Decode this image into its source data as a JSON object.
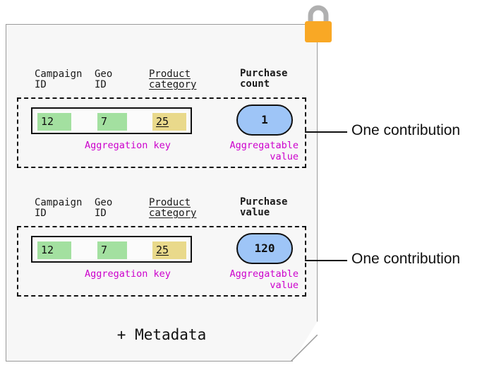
{
  "document": {
    "metadata_label": "+ Metadata",
    "lock_icon": "padlock-icon",
    "sheet_color": "#f7f7f7",
    "border_color": "#9a9a9a"
  },
  "colors": {
    "key_green": "#a3e0a0",
    "key_yellow": "#e9d98b",
    "value_blue": "#9ec5f7",
    "annotation_purple": "#cc00cc",
    "lock_body": "#f9a825",
    "lock_shackle": "#b0b0b0"
  },
  "contributions": [
    {
      "headers": {
        "campaign": "Campaign\nID",
        "geo": "Geo\nID",
        "product": "Product\ncategory",
        "metric": "Purchase\ncount"
      },
      "key": {
        "campaign_id": "12",
        "geo_id": "7",
        "product_category": "25"
      },
      "value": "1",
      "key_label": "Aggregation key",
      "value_label": "Aggregatable\nvalue",
      "callout": "One contribution"
    },
    {
      "headers": {
        "campaign": "Campaign\nID",
        "geo": "Geo\nID",
        "product": "Product\ncategory",
        "metric": "Purchase\nvalue"
      },
      "key": {
        "campaign_id": "12",
        "geo_id": "7",
        "product_category": "25"
      },
      "value": "120",
      "key_label": "Aggregation key",
      "value_label": "Aggregatable\nvalue",
      "callout": "One contribution"
    }
  ]
}
